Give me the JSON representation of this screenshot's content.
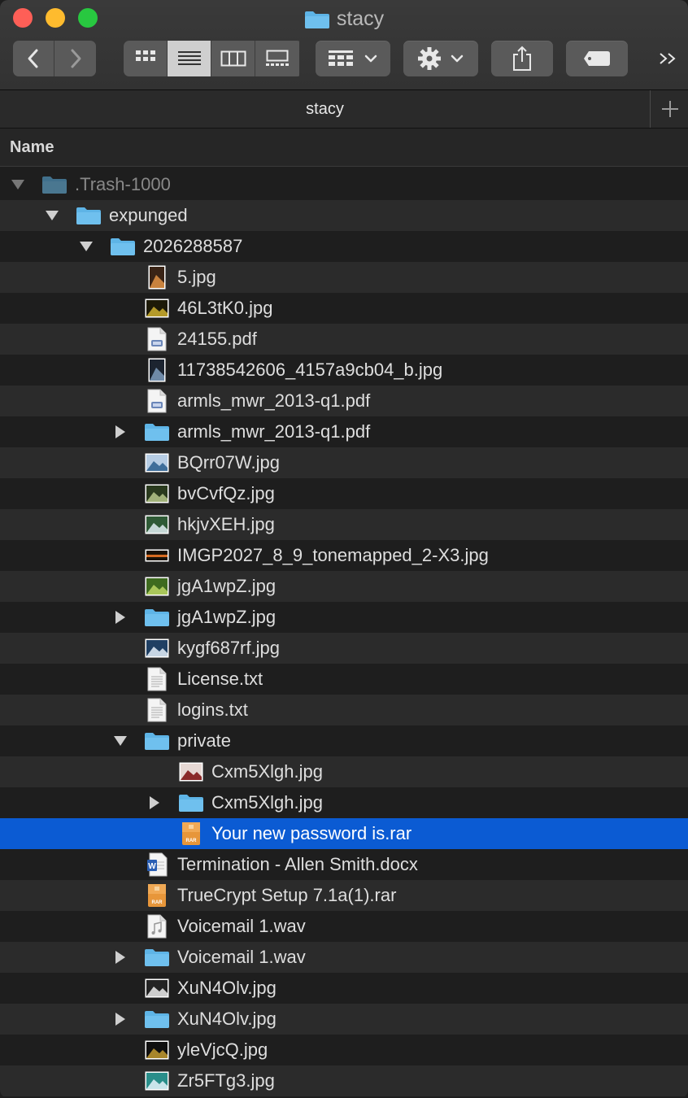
{
  "window": {
    "title": "stacy",
    "tab_label": "stacy",
    "column_header": "Name"
  },
  "toolbar": {
    "buttons": [
      "back",
      "forward",
      "icon-view",
      "list-view",
      "column-view",
      "gallery-view",
      "group-by",
      "action-gear",
      "share",
      "tags",
      "more"
    ],
    "more_label": ">>"
  },
  "colors": {
    "folder": "#5eb4e6",
    "selection": "#0b5bd3",
    "rar": "#e7963a"
  },
  "rows": [
    {
      "name": ".Trash-1000",
      "level": 0,
      "kind": "folder",
      "disclosure": "open",
      "dim": true
    },
    {
      "name": "expunged",
      "level": 1,
      "kind": "folder",
      "disclosure": "open"
    },
    {
      "name": "2026288587",
      "level": 2,
      "kind": "folder",
      "disclosure": "open"
    },
    {
      "name": "5.jpg",
      "level": 3,
      "kind": "image",
      "thumb": "portrait"
    },
    {
      "name": "46L3tK0.jpg",
      "level": 3,
      "kind": "image",
      "thumb": "dark-gold"
    },
    {
      "name": "24155.pdf",
      "level": 3,
      "kind": "pdf"
    },
    {
      "name": "11738542606_4157a9cb04_b.jpg",
      "level": 3,
      "kind": "image",
      "thumb": "portrait-dark"
    },
    {
      "name": "armls_mwr_2013-q1.pdf",
      "level": 3,
      "kind": "pdf"
    },
    {
      "name": "armls_mwr_2013-q1.pdf",
      "level": 3,
      "kind": "folder",
      "disclosure": "closed"
    },
    {
      "name": "BQrr07W.jpg",
      "level": 3,
      "kind": "image",
      "thumb": "sky"
    },
    {
      "name": "bvCvfQz.jpg",
      "level": 3,
      "kind": "image",
      "thumb": "forest"
    },
    {
      "name": "hkjvXEH.jpg",
      "level": 3,
      "kind": "image",
      "thumb": "green"
    },
    {
      "name": "IMGP2027_8_9_tonemapped_2-X3.jpg",
      "level": 3,
      "kind": "image",
      "thumb": "panorama"
    },
    {
      "name": "jgA1wpZ.jpg",
      "level": 3,
      "kind": "image",
      "thumb": "grass"
    },
    {
      "name": "jgA1wpZ.jpg",
      "level": 3,
      "kind": "folder",
      "disclosure": "closed"
    },
    {
      "name": "kygf687rf.jpg",
      "level": 3,
      "kind": "image",
      "thumb": "ocean"
    },
    {
      "name": "License.txt",
      "level": 3,
      "kind": "text"
    },
    {
      "name": "logins.txt",
      "level": 3,
      "kind": "text"
    },
    {
      "name": "private",
      "level": 3,
      "kind": "folder",
      "disclosure": "open"
    },
    {
      "name": "Cxm5Xlgh.jpg",
      "level": 4,
      "kind": "image",
      "thumb": "face"
    },
    {
      "name": "Cxm5Xlgh.jpg",
      "level": 4,
      "kind": "folder",
      "disclosure": "closed"
    },
    {
      "name": "Your new password is.rar",
      "level": 4,
      "kind": "rar",
      "selected": true
    },
    {
      "name": "Termination - Allen Smith.docx",
      "level": 3,
      "kind": "docx"
    },
    {
      "name": "TrueCrypt Setup 7.1a(1).rar",
      "level": 3,
      "kind": "rar"
    },
    {
      "name": "Voicemail 1.wav",
      "level": 3,
      "kind": "audio"
    },
    {
      "name": "Voicemail 1.wav",
      "level": 3,
      "kind": "folder",
      "disclosure": "closed"
    },
    {
      "name": "XuN4Olv.jpg",
      "level": 3,
      "kind": "image",
      "thumb": "mountain"
    },
    {
      "name": "XuN4Olv.jpg",
      "level": 3,
      "kind": "folder",
      "disclosure": "closed"
    },
    {
      "name": "yleVjcQ.jpg",
      "level": 3,
      "kind": "image",
      "thumb": "night"
    },
    {
      "name": "Zr5FTg3.jpg",
      "level": 3,
      "kind": "image",
      "thumb": "beach"
    }
  ]
}
